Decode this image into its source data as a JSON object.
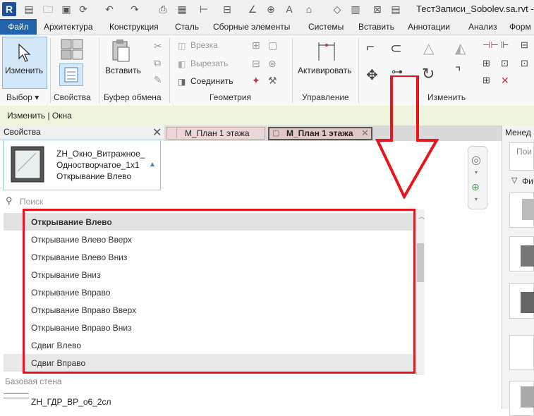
{
  "qat": {
    "logo": "R",
    "title": "ТестЗаписи_Sobolev.sa.rvt -"
  },
  "tabs": [
    "Файл",
    "Архитектура",
    "Конструкция",
    "Сталь",
    "Сборные элементы",
    "Системы",
    "Вставить",
    "Аннотации",
    "Анализ",
    "Форм"
  ],
  "ribbon": {
    "modify_label": "Изменить",
    "paste_label": "Вставить",
    "cut_label": "Врезка",
    "cutout_label": "Вырезать",
    "join_label": "Соединить",
    "activate_label": "Активировать",
    "groups": {
      "select": "Выбор",
      "properties": "Свойства",
      "clipboard": "Буфер обмена",
      "geometry": "Геометрия",
      "control": "Управление",
      "modify": "Изменить"
    }
  },
  "context_bar": "Изменить | Окна",
  "properties": {
    "header": "Свойства",
    "type_line1": "ZH_Окно_Витражное_",
    "type_line2": "Одностворчатое_1х1",
    "type_line3": "Открывание Влево",
    "search_placeholder": "Поиск",
    "base_wall_label": "Базовая стена",
    "base_wall_value": "ZH_ГДР_ВР_о6_2сл"
  },
  "view_tabs": [
    "М_План 1 этажа",
    "М_План 1 этажа"
  ],
  "dropdown_items": [
    "Открывание Влево",
    "Открывание Влево Вверх",
    "Открывание Влево Вниз",
    "Открывание Вниз",
    "Открывание Вправо",
    "Открывание Вправо Вверх",
    "Открывание Вправо Вниз",
    "Сдвиг Влево",
    "Сдвиг Вправо"
  ],
  "right_panel": {
    "title": "Менед",
    "search_placeholder": "Пои",
    "filter_label": "Фи"
  },
  "colors": {
    "file_tab": "#2162a8",
    "highlight_box": "#e8141e",
    "context_bar": "#eef3dc"
  }
}
